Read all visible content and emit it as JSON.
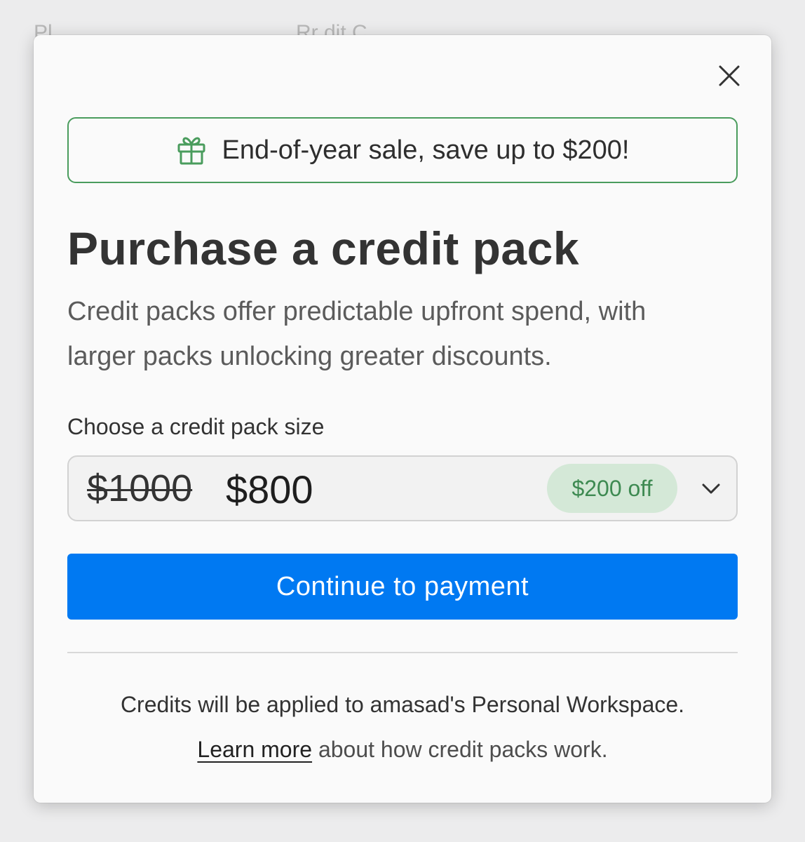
{
  "background": {
    "partial_labels": [
      "Pl",
      "Rr dit C"
    ]
  },
  "modal": {
    "close_icon": "close-icon",
    "banner": {
      "icon": "gift-icon",
      "text": "End-of-year sale, save up to $200!"
    },
    "title": "Purchase a credit pack",
    "description": "Credit packs offer predictable upfront spend, with larger packs unlocking greater discounts.",
    "select": {
      "label": "Choose a credit pack size",
      "original_price": "$1000",
      "price": "$800",
      "discount": "$200 off",
      "chevron_icon": "chevron-down-icon"
    },
    "cta_label": "Continue to payment",
    "footer": {
      "workspace_note": "Credits will be applied to amasad's Personal Workspace.",
      "learn_more_link": "Learn more",
      "learn_more_suffix": " about how credit packs work."
    }
  },
  "colors": {
    "accent": "#0079f2",
    "banner_border": "#4a9c5d",
    "badge_bg": "#d4e8d7",
    "badge_text": "#3e8a52"
  }
}
